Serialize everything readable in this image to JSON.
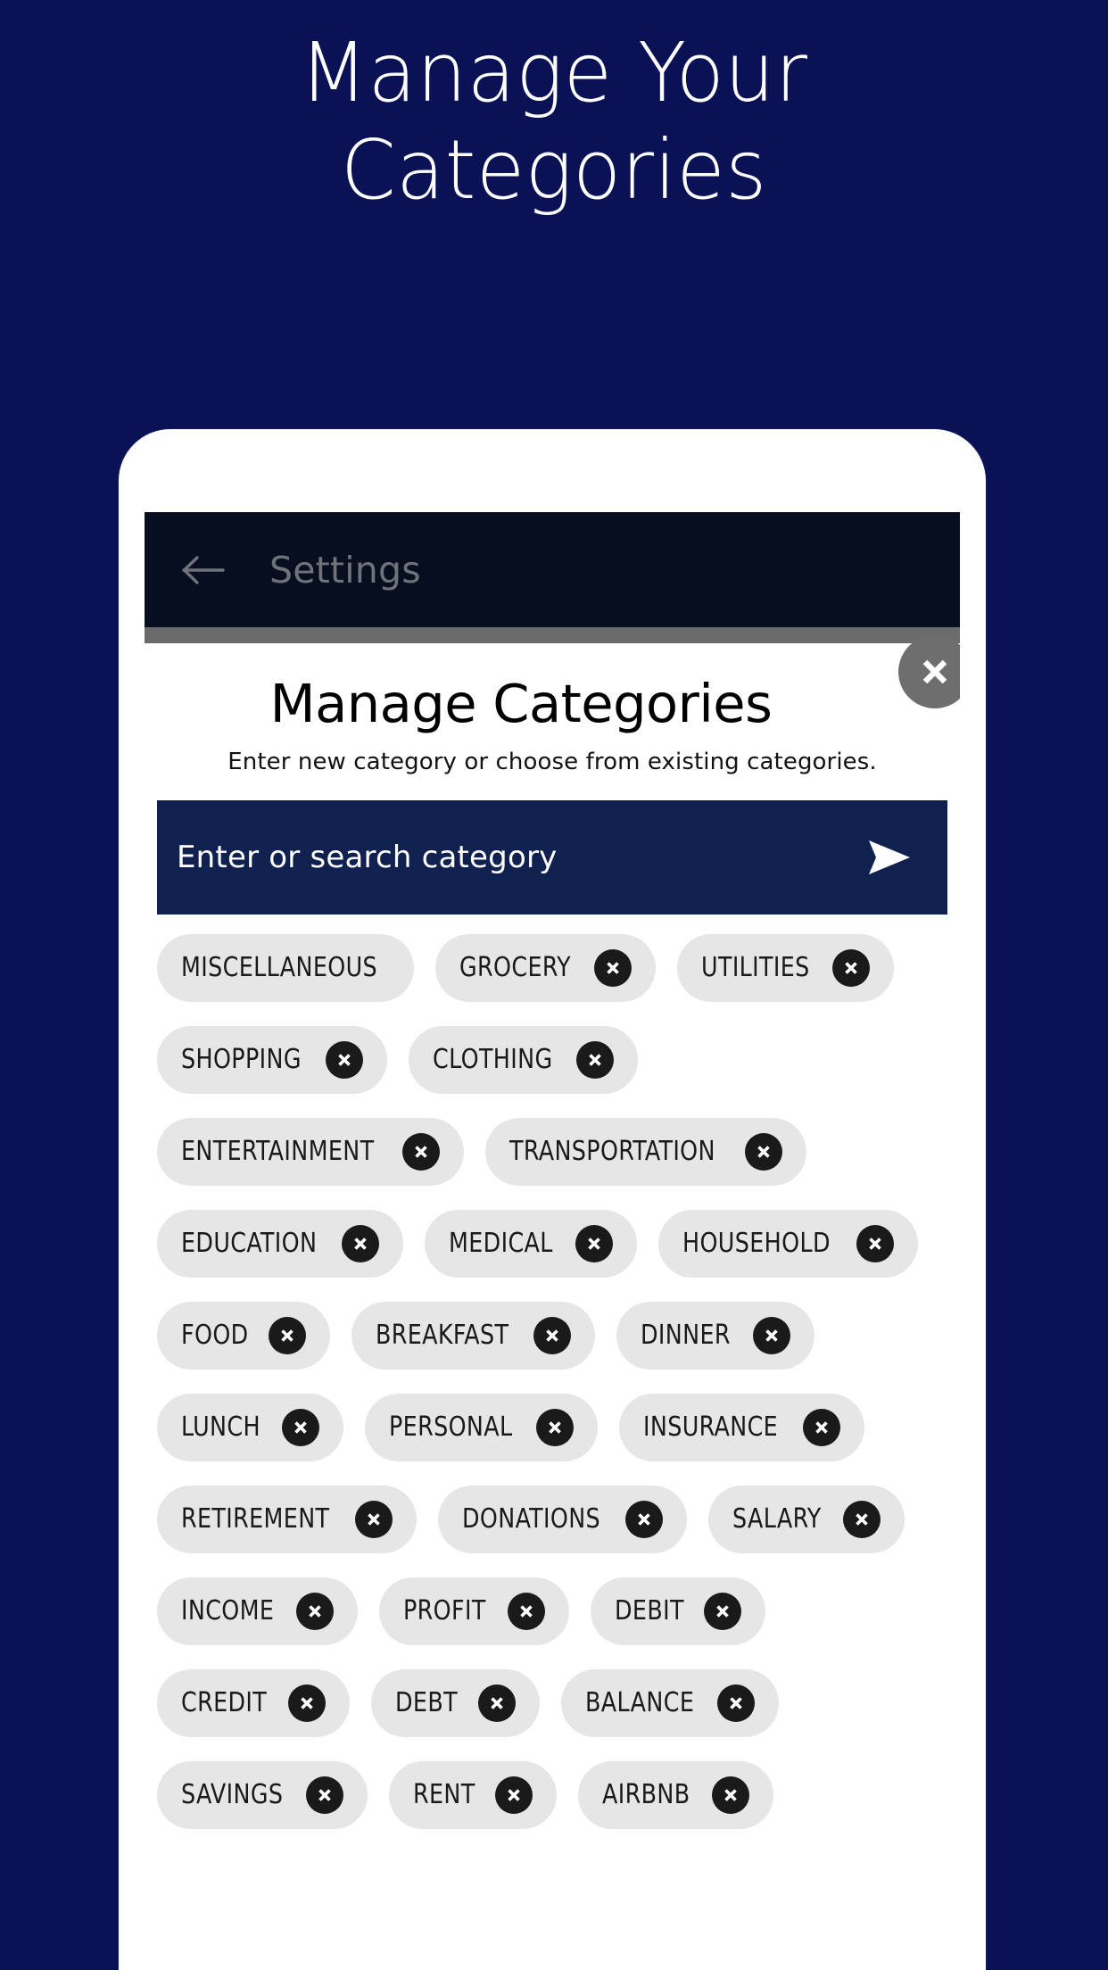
{
  "hero": {
    "line1": "Manage Your",
    "line2": "Categories"
  },
  "colors": {
    "background": "#0a1155",
    "toolbar": "#070e1f",
    "search_field": "#10204f",
    "chip_background": "#e6e6e6",
    "chip_text": "#1a1a1a",
    "close_button": "#6e6e6e",
    "divider": "#6b6b6b"
  },
  "toolbar": {
    "back_icon": "arrow-left-icon",
    "title": "Settings"
  },
  "dialog": {
    "title": "Manage Categories",
    "subtitle": "Enter new category or choose from existing categories.",
    "close_icon": "close-icon"
  },
  "search": {
    "placeholder": "Enter or search category",
    "value": "",
    "send_icon": "send-icon"
  },
  "categories": {
    "rows": [
      [
        {
          "label": "MISCELLANEOUS",
          "removable": false
        },
        {
          "label": "GROCERY",
          "removable": true
        },
        {
          "label": "UTILITIES",
          "removable": true
        }
      ],
      [
        {
          "label": "SHOPPING",
          "removable": true
        },
        {
          "label": "CLOTHING",
          "removable": true
        }
      ],
      [
        {
          "label": "ENTERTAINMENT",
          "removable": true
        },
        {
          "label": "TRANSPORTATION",
          "removable": true
        }
      ],
      [
        {
          "label": "EDUCATION",
          "removable": true
        },
        {
          "label": "MEDICAL",
          "removable": true
        },
        {
          "label": "HOUSEHOLD",
          "removable": true
        }
      ],
      [
        {
          "label": "FOOD",
          "removable": true
        },
        {
          "label": "BREAKFAST",
          "removable": true
        },
        {
          "label": "DINNER",
          "removable": true
        }
      ],
      [
        {
          "label": "LUNCH",
          "removable": true
        },
        {
          "label": "PERSONAL",
          "removable": true
        },
        {
          "label": "INSURANCE",
          "removable": true
        }
      ],
      [
        {
          "label": "RETIREMENT",
          "removable": true
        },
        {
          "label": "DONATIONS",
          "removable": true
        },
        {
          "label": "SALARY",
          "removable": true
        }
      ],
      [
        {
          "label": "INCOME",
          "removable": true
        },
        {
          "label": "PROFIT",
          "removable": true
        },
        {
          "label": "DEBIT",
          "removable": true
        }
      ],
      [
        {
          "label": "CREDIT",
          "removable": true
        },
        {
          "label": "DEBT",
          "removable": true
        },
        {
          "label": "BALANCE",
          "removable": true
        }
      ],
      [
        {
          "label": "SAVINGS",
          "removable": true
        },
        {
          "label": "RENT",
          "removable": true
        },
        {
          "label": "AIRBNB",
          "removable": true
        }
      ]
    ]
  }
}
